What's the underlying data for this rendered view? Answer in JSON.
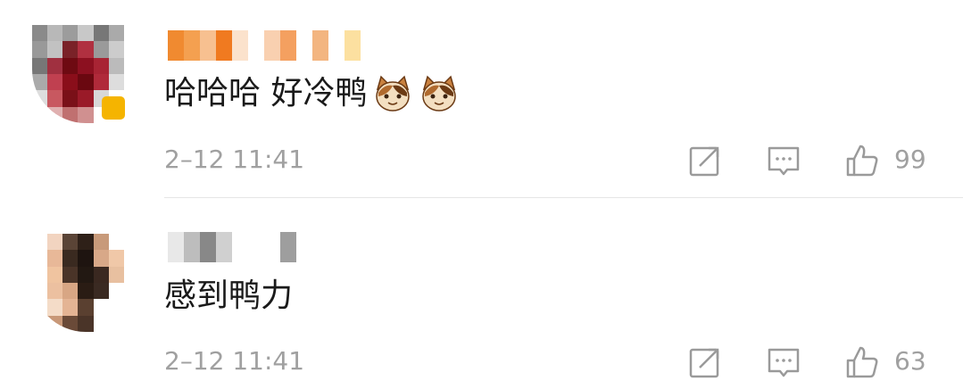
{
  "comments": [
    {
      "text": "哈哈哈 好冷鸭",
      "emoji_count": 2,
      "emoji_icon": "cat-face-emoji",
      "timestamp": "2–12 11:41",
      "like_count": "99",
      "has_vip_badge": true
    },
    {
      "text": "感到鸭力",
      "emoji_count": 0,
      "timestamp": "2–12 11:41",
      "like_count": "63",
      "has_vip_badge": false
    }
  ],
  "icons": {
    "repost": "repost-icon",
    "reply": "comment-icon",
    "like": "thumbs-up-icon"
  },
  "colors": {
    "text": "#1a1a1a",
    "meta": "#a0a0a0",
    "divider": "#e6e6e6",
    "vip": "#f5b400"
  }
}
